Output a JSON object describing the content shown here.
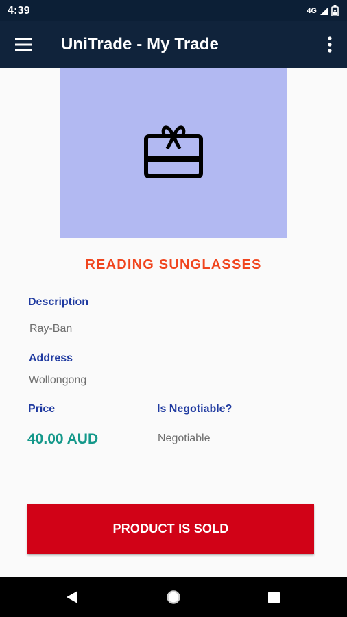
{
  "status_bar": {
    "time": "4:39",
    "network": "4G",
    "icons": [
      "signal-icon",
      "battery-icon"
    ]
  },
  "app_bar": {
    "title": "UniTrade - My Trade",
    "menu_icon": "hamburger-menu-icon",
    "overflow_icon": "more-vert-icon",
    "background": "#10233b"
  },
  "product": {
    "image_icon": "gift-card-icon",
    "image_background": "#b2b9f2",
    "title": "READING SUNGLASSES",
    "description_label": "Description",
    "description": "Ray-Ban",
    "address_label": "Address",
    "address": "Wollongong",
    "price_label": "Price",
    "price": "40.00 AUD",
    "negotiable_label": "Is Negotiable?",
    "negotiable": "Negotiable"
  },
  "action": {
    "sold_label": "PRODUCT IS SOLD",
    "color": "#d10217"
  },
  "nav_bar": {
    "icons": [
      "back-icon",
      "home-icon",
      "recents-icon"
    ]
  }
}
